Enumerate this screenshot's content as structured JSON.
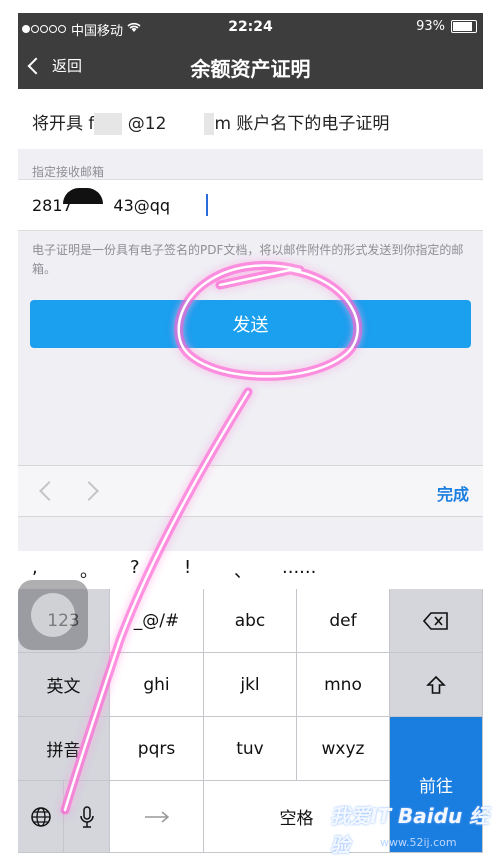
{
  "status_bar": {
    "carrier": "中国移动",
    "time": "22:24",
    "battery": "93%"
  },
  "nav": {
    "back_label": "返回",
    "title": "余额资产证明"
  },
  "form": {
    "account_prefix": "将开具 f",
    "account_mid": "@12",
    "account_suffix": "m 账户名下的电子证明",
    "email_section_label": "指定接收邮箱",
    "email_value": "2817        43@qq",
    "note": "电子证明是一份具有电子签名的PDF文档，将以邮件附件的形式发送到你指定的邮箱。",
    "send_label": "发送"
  },
  "toolbar": {
    "done_label": "完成"
  },
  "candidates": [
    ",",
    "。",
    "?",
    "!",
    "、",
    "......"
  ],
  "keyboard": {
    "row1": [
      "123",
      "_@/#",
      "abc",
      "def"
    ],
    "row2": [
      "英文",
      "ghi",
      "jkl",
      "mno"
    ],
    "row3": [
      "拼音",
      "pqrs",
      "tuv",
      "wxyz"
    ],
    "space_label": "空格",
    "go_label": "前往"
  },
  "watermark": {
    "text": "我爱IT Baidu 经验",
    "sub": "www.52ij.com"
  },
  "colors": {
    "nav_bg": "#3d3d3d",
    "send_button": "#1aa0ee",
    "done_text": "#1a7de0",
    "go_key": "#1a7de0",
    "annotation": "#ff3ccf"
  }
}
